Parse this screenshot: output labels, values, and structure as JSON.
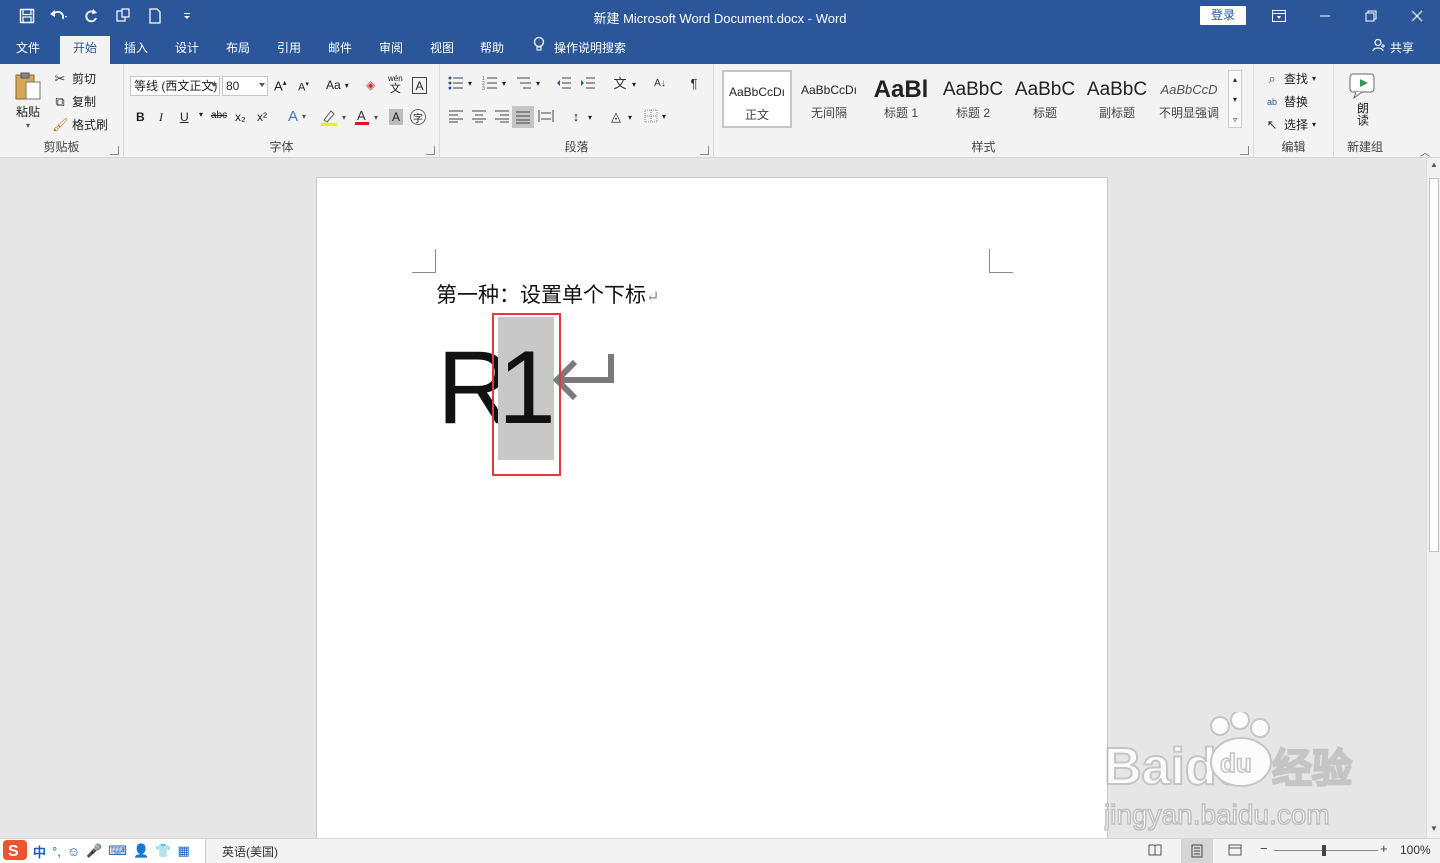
{
  "titlebar": {
    "title": "新建 Microsoft Word Document.docx  -  Word",
    "login_label": "登录",
    "qat_icons": [
      "save-icon",
      "undo-icon",
      "redo-icon",
      "touch-mode-icon",
      "new-doc-icon",
      "customize-qat-icon"
    ]
  },
  "tabs": [
    {
      "label": "文件"
    },
    {
      "label": "开始"
    },
    {
      "label": "插入"
    },
    {
      "label": "设计"
    },
    {
      "label": "布局"
    },
    {
      "label": "引用"
    },
    {
      "label": "邮件"
    },
    {
      "label": "审阅"
    },
    {
      "label": "视图"
    },
    {
      "label": "帮助"
    }
  ],
  "tell_me": "操作说明搜索",
  "share_label": "共享",
  "ribbon": {
    "clipboard": {
      "label": "剪贴板",
      "paste": "粘贴",
      "cut": "剪切",
      "copy": "复制",
      "format_painter": "格式刷"
    },
    "font": {
      "label": "字体",
      "font_name": "等线 (西文正文)",
      "font_size": "80",
      "change_case": "Aa",
      "pinyin": "wén",
      "pinyin_char": "文",
      "bold": "B",
      "italic": "I",
      "underline": "U",
      "strike": "abc",
      "subscript": "x₂",
      "superscript": "x²"
    },
    "paragraph": {
      "label": "段落"
    },
    "styles": {
      "label": "样式",
      "items": [
        {
          "sample": "AaBbCcDı",
          "name": "正文"
        },
        {
          "sample": "AaBbCcDı",
          "name": "无间隔"
        },
        {
          "sample": "AaBl",
          "name": "标题 1"
        },
        {
          "sample": "AaBbC",
          "name": "标题 2"
        },
        {
          "sample": "AaBbC",
          "name": "标题"
        },
        {
          "sample": "AaBbC",
          "name": "副标题"
        },
        {
          "sample": "AaBbCcD",
          "name": "不明显强调"
        }
      ]
    },
    "editing": {
      "label": "编辑",
      "find": "查找",
      "replace": "替换",
      "select": "选择"
    },
    "new_group": {
      "label": "新建组",
      "read_aloud": "朗读"
    }
  },
  "document": {
    "line1": "第一种：设置单个下标",
    "big_r": "R",
    "big_1": "1"
  },
  "statusbar": {
    "ime_label": "中",
    "language": "英语(美国)",
    "zoom": "100%"
  },
  "watermark": {
    "brand": "Baidu",
    "brand_cn": "经验",
    "url": "jingyan.baidu.com"
  },
  "colors": {
    "title_blue": "#2b579a",
    "selection_box": "#e0393e",
    "selection_fill": "#c8c8c8"
  }
}
